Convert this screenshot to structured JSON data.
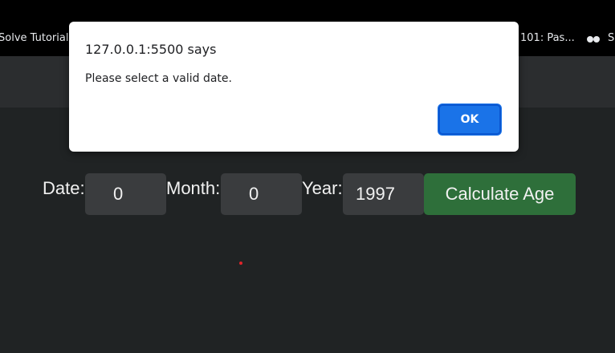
{
  "browser": {
    "bookmarks": {
      "left_item": "Solve Tutorials",
      "right_item": "101: Pas...",
      "far_right_item": "S"
    }
  },
  "form": {
    "date_label": "Date:",
    "date_value": "0",
    "month_label": "Month:",
    "month_value": "0",
    "year_label": "Year:",
    "year_value": "1997",
    "calculate_button": "Calculate Age"
  },
  "alert": {
    "title": "127.0.0.1:5500 says",
    "message": "Please select a valid date.",
    "ok_label": "OK"
  },
  "colors": {
    "background": "#202324",
    "button_green": "#2e6f3a",
    "ok_blue": "#1a73e8"
  }
}
